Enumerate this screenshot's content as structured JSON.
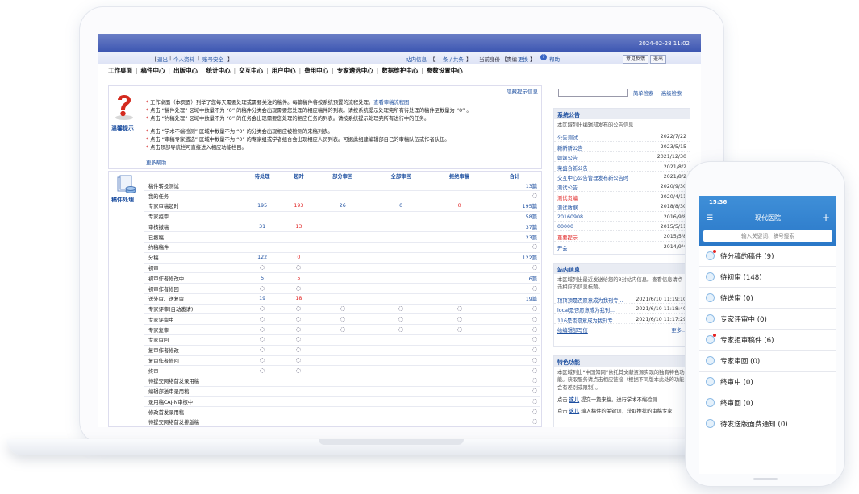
{
  "datetime": "2024-02-28 11:02",
  "topbar": {
    "logout": "退出",
    "profile": "个人资料",
    "security": "账号安全",
    "site_msg": "站内信息",
    "msg_count": "条 / 共条",
    "role_label": "当前身份",
    "role": "责编",
    "switch": "更换",
    "help": "帮助",
    "feedback": "意见反馈",
    "exit": "退出"
  },
  "nav": [
    "工作桌面",
    "稿件中心",
    "出版中心",
    "统计中心",
    "交互中心",
    "用户中心",
    "费用中心",
    "专家遴选中心",
    "数据维护中心",
    "参数设置中心"
  ],
  "tips": {
    "hide": "隐藏提示信息",
    "label": "温馨提示",
    "lines": [
      "工作桌面（本页面）列举了您每天需要处理或需要关注的稿件。每篇稿件将按系统预置的流程处理。",
      "点击 “稿件处理” 区域中数量不为 “0” 的稿件分类会出现需要您处理的相应稿件的列表。请按系统提示处理完所有待处理的稿件至数量为 “0” 。",
      "点击 “约稿处理” 区域中数量不为 “0” 的任务会出现需要您处理的相应任务的列表。请按系统提示处理完所有进行中的任务。",
      "点击 “学术不端检测” 区域中数量不为 “0” 的分类会出现相应被检测的来稿列表。",
      "点击 “审稿专家遴选” 区域中数量不为 “0” 的专家组或学者组合会出现相应人员列表。可据此组建编辑部自己的审稿队伍或作者队伍。",
      "点击顶部导航栏可直接进入相应功能栏目。"
    ],
    "flow_link": "查看审稿流程图",
    "more": "更多帮助......"
  },
  "manuscripts": {
    "label": "稿件处理",
    "headers": [
      "待处理",
      "超时",
      "部分审回",
      "全部审回",
      "拒绝审稿",
      "合计"
    ],
    "rows": [
      {
        "label": "稿件转投测试",
        "v": [
          "",
          "",
          "",
          "",
          "",
          "13篇"
        ]
      },
      {
        "label": "我的任务",
        "v": [
          "",
          "",
          "",
          "",
          "",
          "~"
        ]
      },
      {
        "label": "专家审稿超时",
        "v": [
          "195",
          "193",
          "26",
          "0",
          "0",
          "195篇"
        ]
      },
      {
        "label": "专家拒审",
        "v": [
          "",
          "",
          "",
          "",
          "",
          "58篇"
        ]
      },
      {
        "label": "审核撤稿",
        "v": [
          "31",
          "13",
          "",
          "",
          "",
          "37篇"
        ]
      },
      {
        "label": "已撤稿",
        "v": [
          "",
          "",
          "",
          "",
          "",
          "23篇"
        ]
      },
      {
        "label": "约稿稿件",
        "v": [
          "",
          "",
          "",
          "",
          "",
          "~"
        ]
      },
      {
        "label": "分稿",
        "v": [
          "122",
          "0",
          "",
          "",
          "",
          "122篇"
        ]
      },
      {
        "label": "初审",
        "v": [
          "~",
          "~",
          "",
          "",
          "",
          "~"
        ]
      },
      {
        "label": "初审作者修改中",
        "v": [
          "5",
          "5",
          "",
          "",
          "",
          "6篇"
        ]
      },
      {
        "label": "初审作者修回",
        "v": [
          "~",
          "~",
          "",
          "",
          "",
          "~"
        ]
      },
      {
        "label": "送外审、送复审",
        "v": [
          "19",
          "18",
          "",
          "",
          "",
          "19篇"
        ]
      },
      {
        "label": "专家评审(自动邀请)",
        "v": [
          "~",
          "~",
          "~",
          "~",
          "~",
          "~"
        ]
      },
      {
        "label": "专家评审中",
        "v": [
          "~",
          "~",
          "~",
          "~",
          "~",
          "~"
        ]
      },
      {
        "label": "专家复审",
        "v": [
          "~",
          "~",
          "~",
          "~",
          "~",
          "~"
        ]
      },
      {
        "label": "专家审回",
        "v": [
          "~",
          "~",
          "",
          "",
          "",
          "~"
        ]
      },
      {
        "label": "复审作者修改",
        "v": [
          "~",
          "~",
          "",
          "",
          "",
          "~"
        ]
      },
      {
        "label": "复审作者修回",
        "v": [
          "~",
          "~",
          "",
          "",
          "",
          "~"
        ]
      },
      {
        "label": "终审",
        "v": [
          "~",
          "~",
          "",
          "",
          "",
          "~"
        ]
      },
      {
        "label": "待提交网络首发录用稿",
        "v": [
          "",
          "",
          "",
          "",
          "",
          "~"
        ]
      },
      {
        "label": "编辑部送审录用稿",
        "v": [
          "",
          "",
          "",
          "",
          "",
          "~"
        ]
      },
      {
        "label": "录用稿CAJ-N审核中",
        "v": [
          "",
          "",
          "",
          "",
          "",
          "~"
        ]
      },
      {
        "label": "修改首发录用稿",
        "v": [
          "",
          "",
          "",
          "",
          "",
          "~"
        ]
      },
      {
        "label": "待提交网络首发排版稿",
        "v": [
          "",
          "",
          "",
          "",
          "",
          "~"
        ]
      }
    ]
  },
  "search": {
    "simple": "简单检索",
    "advanced": "高级检索"
  },
  "notice": {
    "title": "系统公告",
    "desc": "本区域列出编辑部发布的公告信息",
    "items": [
      {
        "t": "公告测试",
        "d": "2022/7/22",
        "red": false
      },
      {
        "t": "新新新公告",
        "d": "2023/5/15",
        "red": false
      },
      {
        "t": "飒飒公告",
        "d": "2021/12/30",
        "red": false
      },
      {
        "t": "荣盛合新公告",
        "d": "2021/8/2",
        "red": false
      },
      {
        "t": "交互中心公告管理发布新公告时",
        "d": "2021/8/2",
        "red": false
      },
      {
        "t": "测试公告",
        "d": "2020/9/30",
        "red": false
      },
      {
        "t": "测试贵编",
        "d": "2020/4/11",
        "red": true
      },
      {
        "t": "测试数据",
        "d": "2018/8/30",
        "red": false
      },
      {
        "t": "20160908",
        "d": "2016/9/8",
        "red": false
      },
      {
        "t": "00000",
        "d": "2015/5/11",
        "red": false
      },
      {
        "t": "重要提示",
        "d": "2015/5/8",
        "red": true
      },
      {
        "t": "开会",
        "d": "2014/9/4",
        "red": false
      }
    ]
  },
  "inbox": {
    "title": "站内信息",
    "desc": "本区域列出最近发送给您的3封站内信息。查看信息请点击相应的信息标题。",
    "items": [
      {
        "t": "顶顶顶是否愿意成为我刊专...",
        "d": "2021/6/10 11:19:10"
      },
      {
        "t": "local是否愿意成为我刊...",
        "d": "2021/6/10 11:18:40"
      },
      {
        "t": "116是否愿意成为我刊专...",
        "d": "2021/6/10 11:17:29"
      }
    ],
    "write": "给编辑部写信",
    "more": "更多..."
  },
  "features": {
    "title": "特色功能",
    "desc": "本区域列出“中国知网”依托其文献资源实现的独有特色功能。获取服务请点击相应链接（根据不同版本此处的功能会有差别或限制）。",
    "line1_a": "点击",
    "line1_link": "这儿",
    "line1_b": "提交一篇来稿。进行学术不端检测",
    "line2_a": "点击",
    "line2_link": "这儿",
    "line2_b": "输入稿件的关键词，获取推荐的审稿专家"
  },
  "phone": {
    "time": "15:36",
    "title": "现代医院",
    "search_placeholder": "输入关键词、稿号搜索",
    "items": [
      {
        "label": "待分稿的稿件 (9)",
        "dot": true
      },
      {
        "label": "待初审 (148)",
        "dot": false
      },
      {
        "label": "待送审 (0)",
        "dot": false
      },
      {
        "label": "专家评审中 (0)",
        "dot": false
      },
      {
        "label": "专家拒审稿件 (6)",
        "dot": true
      },
      {
        "label": "专家审回 (0)",
        "dot": false
      },
      {
        "label": "终审中 (0)",
        "dot": false
      },
      {
        "label": "终审回 (0)",
        "dot": false
      },
      {
        "label": "待发送版面费通知 (0)",
        "dot": false
      }
    ]
  }
}
